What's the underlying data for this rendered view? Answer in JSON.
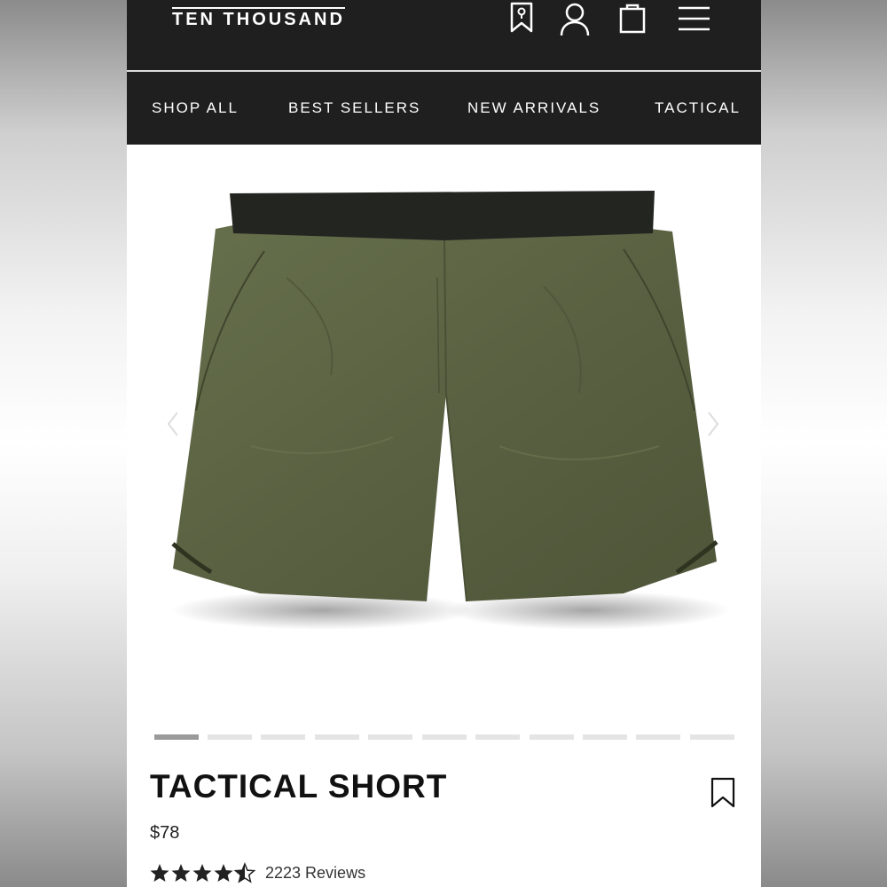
{
  "header": {
    "brand": "TEN THOUSAND",
    "icons": [
      "bookmark-icon",
      "user-icon",
      "bag-icon",
      "menu-icon"
    ]
  },
  "nav": {
    "items": [
      {
        "label": "SHOP ALL"
      },
      {
        "label": "BEST SELLERS"
      },
      {
        "label": "NEW ARRIVALS"
      },
      {
        "label": "TACTICAL"
      }
    ]
  },
  "gallery": {
    "image_count": 11,
    "active_index": 0,
    "product_color": "#5a6142",
    "waistband_color": "#232521"
  },
  "product": {
    "title": "TACTICAL SHORT",
    "price": "$78",
    "rating": 4.5,
    "rating_max": 5,
    "reviews": "2223 Reviews"
  },
  "colors": {
    "header_bg": "#1f1f1f",
    "text_light": "#ffffff",
    "text_dark": "#111111"
  }
}
